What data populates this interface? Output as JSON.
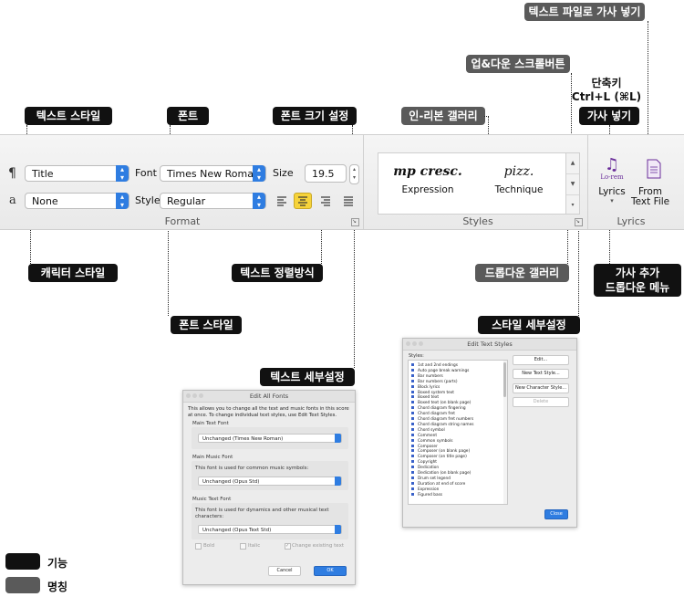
{
  "callouts": {
    "text_style": "텍스트 스타일",
    "font": "폰트",
    "font_size": "폰트 크기 설정",
    "inline_gallery": "인-리본 갤러리",
    "updown_scroll": "업&다운 스크롤버튼",
    "text_file_lyrics": "텍스트 파일로 가사 넣기",
    "shortcut_line1": "단축키",
    "shortcut_line2": "Ctrl+L (⌘L)",
    "add_lyrics": "가사 넣기",
    "char_style": "캐릭터 스타일",
    "text_align": "텍스트 정렬방식",
    "font_style": "폰트 스타일",
    "dropdown_gallery": "드롭다운 갤러리",
    "lyrics_add_menu_line1": "가사 추가",
    "lyrics_add_menu_line2": "드롭다운 메뉴",
    "style_detail": "스타일 세부설정",
    "text_detail": "텍스트 세부설정"
  },
  "legend": {
    "function": "기능",
    "name": "명칭"
  },
  "ribbon": {
    "paragraph_icon": "¶",
    "char_icon": "a",
    "text_style_value": "Title",
    "char_style_value": "None",
    "font_label": "Font",
    "font_value": "Times New Roman",
    "style_label": "Style",
    "style_value": "Regular",
    "size_label": "Size",
    "size_value": "19.5",
    "format_group": "Format",
    "styles_group": "Styles",
    "lyrics_group": "Lyrics",
    "gallery": [
      {
        "symbol": "mp cresc.",
        "label": "Expression"
      },
      {
        "symbol": "pizz.",
        "label": "Technique"
      }
    ],
    "lyrics_button": {
      "caption": "Lo-rem",
      "label": "Lyrics"
    },
    "from_text_file": {
      "line1": "From",
      "line2": "Text File"
    }
  },
  "fonts_dialog": {
    "title": "Edit All Fonts",
    "intro": "This allows you to change all the text and music fonts in this score at once. To change individual text styles, use Edit Text Styles.",
    "main_text_label": "Main Text Font",
    "main_text_value": "Unchanged (Times New Roman)",
    "main_music_label": "Main Music Font",
    "main_music_desc": "This font is used for common music symbols:",
    "main_music_value": "Unchanged (Opus Std)",
    "music_text_label": "Music Text Font",
    "music_text_desc": "This font is used for dynamics and other musical text characters:",
    "music_text_value": "Unchanged (Opus Text Std)",
    "bold": "Bold",
    "italic": "Italic",
    "change_existing": "Change existing text",
    "cancel": "Cancel",
    "ok": "OK"
  },
  "styles_dialog": {
    "title": "Edit Text Styles",
    "styles_label": "Styles:",
    "edit": "Edit...",
    "new_text_style": "New Text Style...",
    "new_char_style": "New Character Style...",
    "delete": "Delete",
    "close": "Close",
    "items": [
      "1st and 2nd endings",
      "Auto page break warnings",
      "Bar numbers",
      "Bar numbers (parts)",
      "Block lyrics",
      "Boxed system text",
      "Boxed text",
      "Boxed text (on blank page)",
      "Chord diagram fingering",
      "Chord diagram fret",
      "Chord diagram fret numbers",
      "Chord diagram string names",
      "Chord symbol",
      "Comment",
      "Common symbols",
      "Composer",
      "Composer (on blank page)",
      "Composer (on title page)",
      "Copyright",
      "Dedication",
      "Dedication (on blank page)",
      "Drum set legend",
      "Duration at end of score",
      "Expression",
      "Figured bass"
    ]
  },
  "colors": {
    "accent_blue": "#2f7de1",
    "align_active": "#f6d33a",
    "callout_black": "#111111",
    "callout_gray": "#5a5a5a"
  }
}
